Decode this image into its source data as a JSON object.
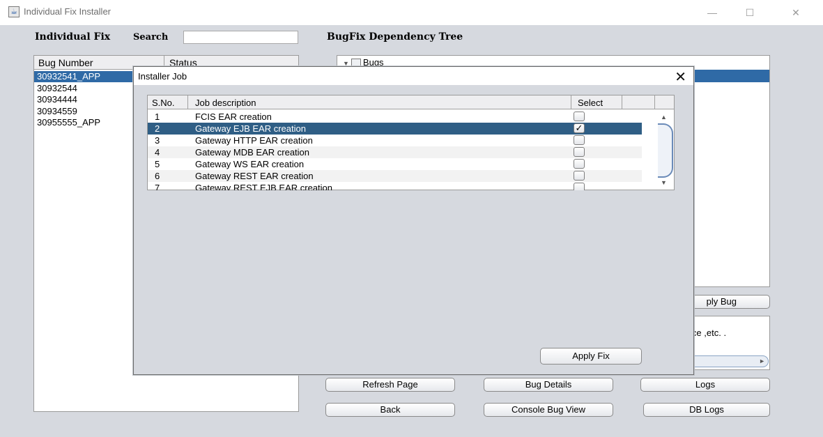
{
  "window": {
    "title": "Individual Fix  Installer",
    "minimize": "—",
    "maximize": "☐",
    "close": "✕"
  },
  "left": {
    "heading": "Individual Fix",
    "search_label": "Search",
    "search_value": "",
    "columns": [
      "Bug Number",
      "Status"
    ],
    "bugs": [
      "30932541_APP",
      "30932544",
      "30934444",
      "30934559",
      "30955555_APP"
    ]
  },
  "right": {
    "heading": "BugFix Dependency Tree",
    "tree_root": "Bugs",
    "apply_bug_button": "ply Bug",
    "info_text": "enance ,etc. .",
    "buttons": {
      "refresh": "Refresh Page",
      "bug_details": "Bug Details",
      "logs": "Logs",
      "back": "Back",
      "console_view": "Console Bug View",
      "db_logs": "DB Logs"
    }
  },
  "dialog": {
    "title": "Installer Job",
    "close": "✕",
    "columns": {
      "no": "S.No.",
      "desc": "Job description",
      "select": "Select"
    },
    "jobs": [
      {
        "no": "1",
        "desc": "FCIS EAR creation",
        "check": ""
      },
      {
        "no": "2",
        "desc": "Gateway EJB EAR creation",
        "check": "✓"
      },
      {
        "no": "3",
        "desc": "Gateway HTTP EAR creation",
        "check": ""
      },
      {
        "no": "4",
        "desc": "Gateway MDB EAR creation",
        "check": ""
      },
      {
        "no": "5",
        "desc": "Gateway WS EAR creation",
        "check": ""
      },
      {
        "no": "6",
        "desc": "Gateway REST EAR creation",
        "check": ""
      },
      {
        "no": "7",
        "desc": "Gateway REST EJB EAR creation",
        "check": ""
      }
    ],
    "apply_fix": "Apply Fix"
  }
}
